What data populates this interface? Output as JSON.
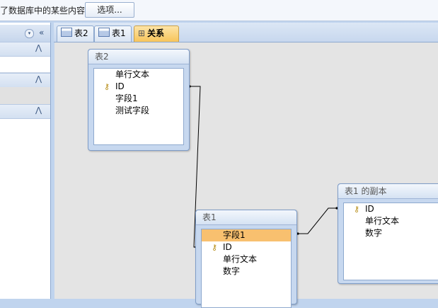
{
  "security_bar": {
    "message": "了数据库中的某些内容",
    "options_button": "选项..."
  },
  "nav_pane": {
    "dropdown_glyph": "▾",
    "collapse_glyph": "«",
    "group_glyph": "⋀"
  },
  "tabs": [
    {
      "label": "表2"
    },
    {
      "label": "表1"
    },
    {
      "label": "关系",
      "active": true
    }
  ],
  "tables": [
    {
      "title": "表2",
      "fields": [
        "单行文本",
        "ID",
        "字段1",
        "测试字段"
      ],
      "key_index": 1
    },
    {
      "title": "表1",
      "fields": [
        "字段1",
        "ID",
        "单行文本",
        "数字"
      ],
      "key_index": 1,
      "selected_index": 0
    },
    {
      "title": "表1 的副本",
      "fields": [
        "ID",
        "单行文本",
        "数字"
      ],
      "key_index": 0
    }
  ],
  "colors": {
    "workspace": "#e4e4e4",
    "selected_field": "#f8c06f",
    "active_tab": "#f7c45a",
    "frame": "#c0d4ee"
  },
  "icons": {
    "key": "key-icon",
    "table": "table-icon",
    "relationships": "relationships-icon"
  }
}
